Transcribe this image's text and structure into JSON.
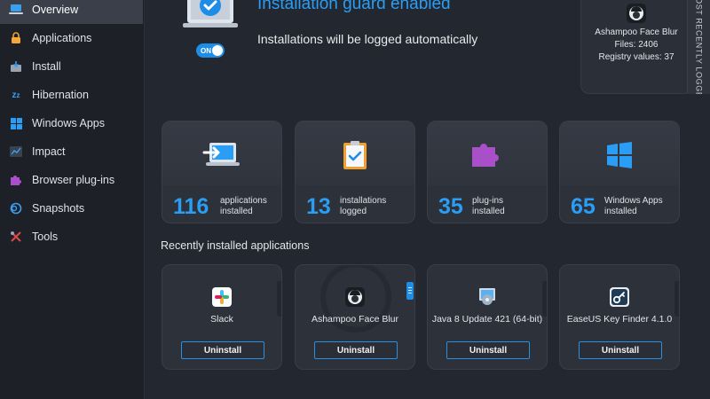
{
  "sidebar": {
    "items": [
      {
        "label": "Overview",
        "icon": "laptop-icon",
        "active": true
      },
      {
        "label": "Applications",
        "icon": "lock-icon",
        "active": false
      },
      {
        "label": "Install",
        "icon": "install-icon",
        "active": false
      },
      {
        "label": "Hibernation",
        "icon": "sleep-icon",
        "active": false
      },
      {
        "label": "Windows Apps",
        "icon": "windows-icon",
        "active": false
      },
      {
        "label": "Impact",
        "icon": "chart-icon",
        "active": false
      },
      {
        "label": "Browser plug-ins",
        "icon": "puzzle-icon",
        "active": false
      },
      {
        "label": "Snapshots",
        "icon": "snapshot-icon",
        "active": false
      },
      {
        "label": "Tools",
        "icon": "tools-icon",
        "active": false
      }
    ]
  },
  "guard": {
    "title": "Installation guard enabled",
    "subtitle": "Installations will be logged automatically",
    "toggle_label": "ON"
  },
  "most_recent": {
    "tab_label": "MOST RECENTLY LOGGED",
    "app_name": "Ashampoo Face Blur",
    "files": "Files: 2406",
    "registry": "Registry values: 37"
  },
  "stats": [
    {
      "value": "116",
      "line1": "applications",
      "line2": "installed",
      "icon": "laptop-arrow-icon"
    },
    {
      "value": "13",
      "line1": "installations",
      "line2": "logged",
      "icon": "clipboard-check-icon"
    },
    {
      "value": "35",
      "line1": "plug-ins",
      "line2": "installed",
      "icon": "puzzle-icon"
    },
    {
      "value": "65",
      "line1": "Windows Apps",
      "line2": "installed",
      "icon": "windows-logo-icon"
    }
  ],
  "recent": {
    "title": "Recently installed applications",
    "apps": [
      {
        "name": "Slack",
        "icon": "slack-icon",
        "button": "Uninstall"
      },
      {
        "name": "Ashampoo Face Blur",
        "icon": "face-blur-icon",
        "button": "Uninstall"
      },
      {
        "name": "Java 8 Update 421 (64-bit)",
        "icon": "java-installer-icon",
        "button": "Uninstall"
      },
      {
        "name": "EaseUS Key Finder 4.1.0",
        "icon": "key-finder-icon",
        "button": "Uninstall"
      }
    ]
  },
  "colors": {
    "accent": "#2a9df4",
    "sidebar_bg": "#1d2027",
    "main_bg": "#23272f",
    "card_bg": "#2d313a",
    "plugin_purple": "#a94fc8"
  }
}
